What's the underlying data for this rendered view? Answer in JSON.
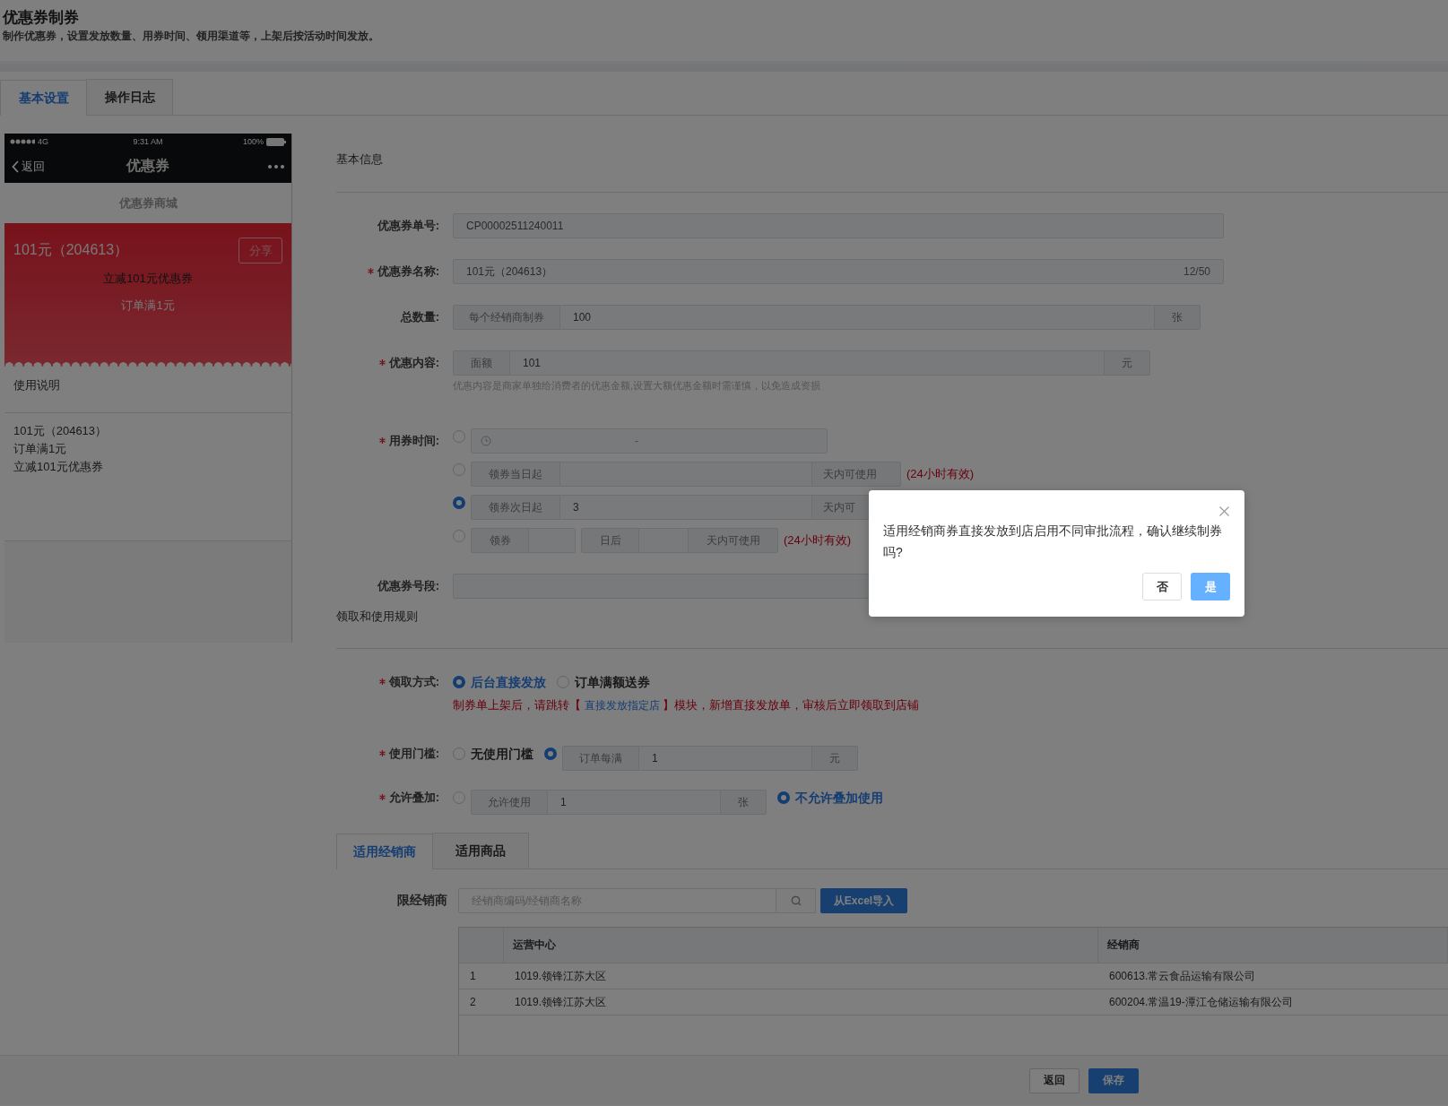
{
  "page": {
    "title": "优惠券制券",
    "subtitle": "制作优惠券，设置发放数量、用券时间、领用渠道等，上架后按活动时间发放。"
  },
  "tabs": [
    {
      "label": "基本设置",
      "selected": true
    },
    {
      "label": "操作日志",
      "selected": false
    }
  ],
  "preview": {
    "status": {
      "network": "4G",
      "time": "9:31 AM",
      "battery": "100%"
    },
    "nav": {
      "back": "返回",
      "title": "优惠券"
    },
    "store_title": "优惠券商城",
    "coupon": {
      "name": "101元（204613）",
      "share": "分享",
      "discount": "立减101元优惠券",
      "condition": "订单满1元"
    },
    "usage_title": "使用说明",
    "usage_lines": [
      "101元（204613）",
      "订单满1元",
      "立减101元优惠券"
    ]
  },
  "basic_info": {
    "title": "基本信息",
    "fields": [
      {
        "kind": "text",
        "label": "优惠券单号:",
        "required": false,
        "value": "CP00002511240011"
      },
      {
        "kind": "text",
        "label": "优惠券名称:",
        "required": true,
        "value": "101元（204613）",
        "counter": "12/50"
      },
      {
        "kind": "addon",
        "label": "总数量:",
        "required": false,
        "prefix": "每个经销商制券",
        "value": "100",
        "suffix": "张"
      },
      {
        "kind": "addon",
        "label": "优惠内容:",
        "required": true,
        "prefix": "面额",
        "value": "101",
        "suffix": "元",
        "hint": "优惠内容是商家单独给消费者的优惠金额,设置大额优惠金额时需谨慎，以免造成资损"
      },
      {
        "kind": "time",
        "label": "用券时间:",
        "required": true,
        "options": [
          {
            "kind": "range",
            "selected": false,
            "separator": "-"
          },
          {
            "kind": "days",
            "selected": false,
            "prefix": "领券当日起",
            "suffix": "天内可使用",
            "note": "(24小时有效)"
          },
          {
            "kind": "days",
            "selected": true,
            "prefix": "领券次日起",
            "value": "3",
            "suffix": "天内可"
          },
          {
            "kind": "delay",
            "selected": false,
            "prefix": "领券",
            "middle": "日后",
            "suffix": "天内可使用",
            "note": "(24小时有效)"
          }
        ]
      },
      {
        "kind": "text",
        "label": "优惠券号段:",
        "required": false
      }
    ]
  },
  "rules": {
    "title": "领取和使用规则",
    "fields": [
      {
        "label": "领取方式:",
        "required": true,
        "options": [
          {
            "kind": "plain",
            "label": "后台直接发放",
            "selected": true
          },
          {
            "kind": "plain",
            "label": "订单满额送券",
            "selected": false
          }
        ],
        "notice": {
          "before": "制券单上架后，请跳转【 ",
          "link": "直接发放指定店",
          "after": " 】模块，新增直接发放单，审核后立即领取到店铺"
        }
      },
      {
        "label": "使用门槛:",
        "required": true,
        "options": [
          {
            "kind": "plain",
            "label": "无使用门槛",
            "selected": false
          },
          {
            "kind": "addon",
            "prefix": "订单每满",
            "value": "1",
            "suffix": "元",
            "selected": true
          }
        ]
      },
      {
        "label": "允许叠加:",
        "required": true,
        "options": [
          {
            "kind": "addon",
            "prefix": "允许使用",
            "value": "1",
            "suffix": "张",
            "selected": false
          },
          {
            "kind": "plain",
            "label": "不允许叠加使用",
            "selected": true
          }
        ]
      }
    ]
  },
  "scope_tabs": [
    {
      "label": "适用经销商",
      "selected": true
    },
    {
      "label": "适用商品",
      "selected": false
    }
  ],
  "dealers": {
    "label": "限经销商",
    "search_placeholder": "经销商编码/经销商名称",
    "import_button": "从Excel导入",
    "columns": [
      "运营中心",
      "经销商"
    ],
    "rows": [
      {
        "index": "1",
        "center": "1019.领锋江苏大区",
        "dealer": "600613.常云食品运输有限公司"
      },
      {
        "index": "2",
        "center": "1019.领锋江苏大区",
        "dealer": "600204.常温19-潭江仓储运输有限公司"
      }
    ]
  },
  "footer_buttons": [
    {
      "label": "返回",
      "kind": "default"
    },
    {
      "label": "保存",
      "kind": "primary"
    }
  ],
  "dialog": {
    "message": "适用经销商券直接发放到店启用不同审批流程，确认继续制券吗?",
    "buttons": [
      {
        "label": "否",
        "kind": "default"
      },
      {
        "label": "是",
        "kind": "primary"
      }
    ]
  }
}
